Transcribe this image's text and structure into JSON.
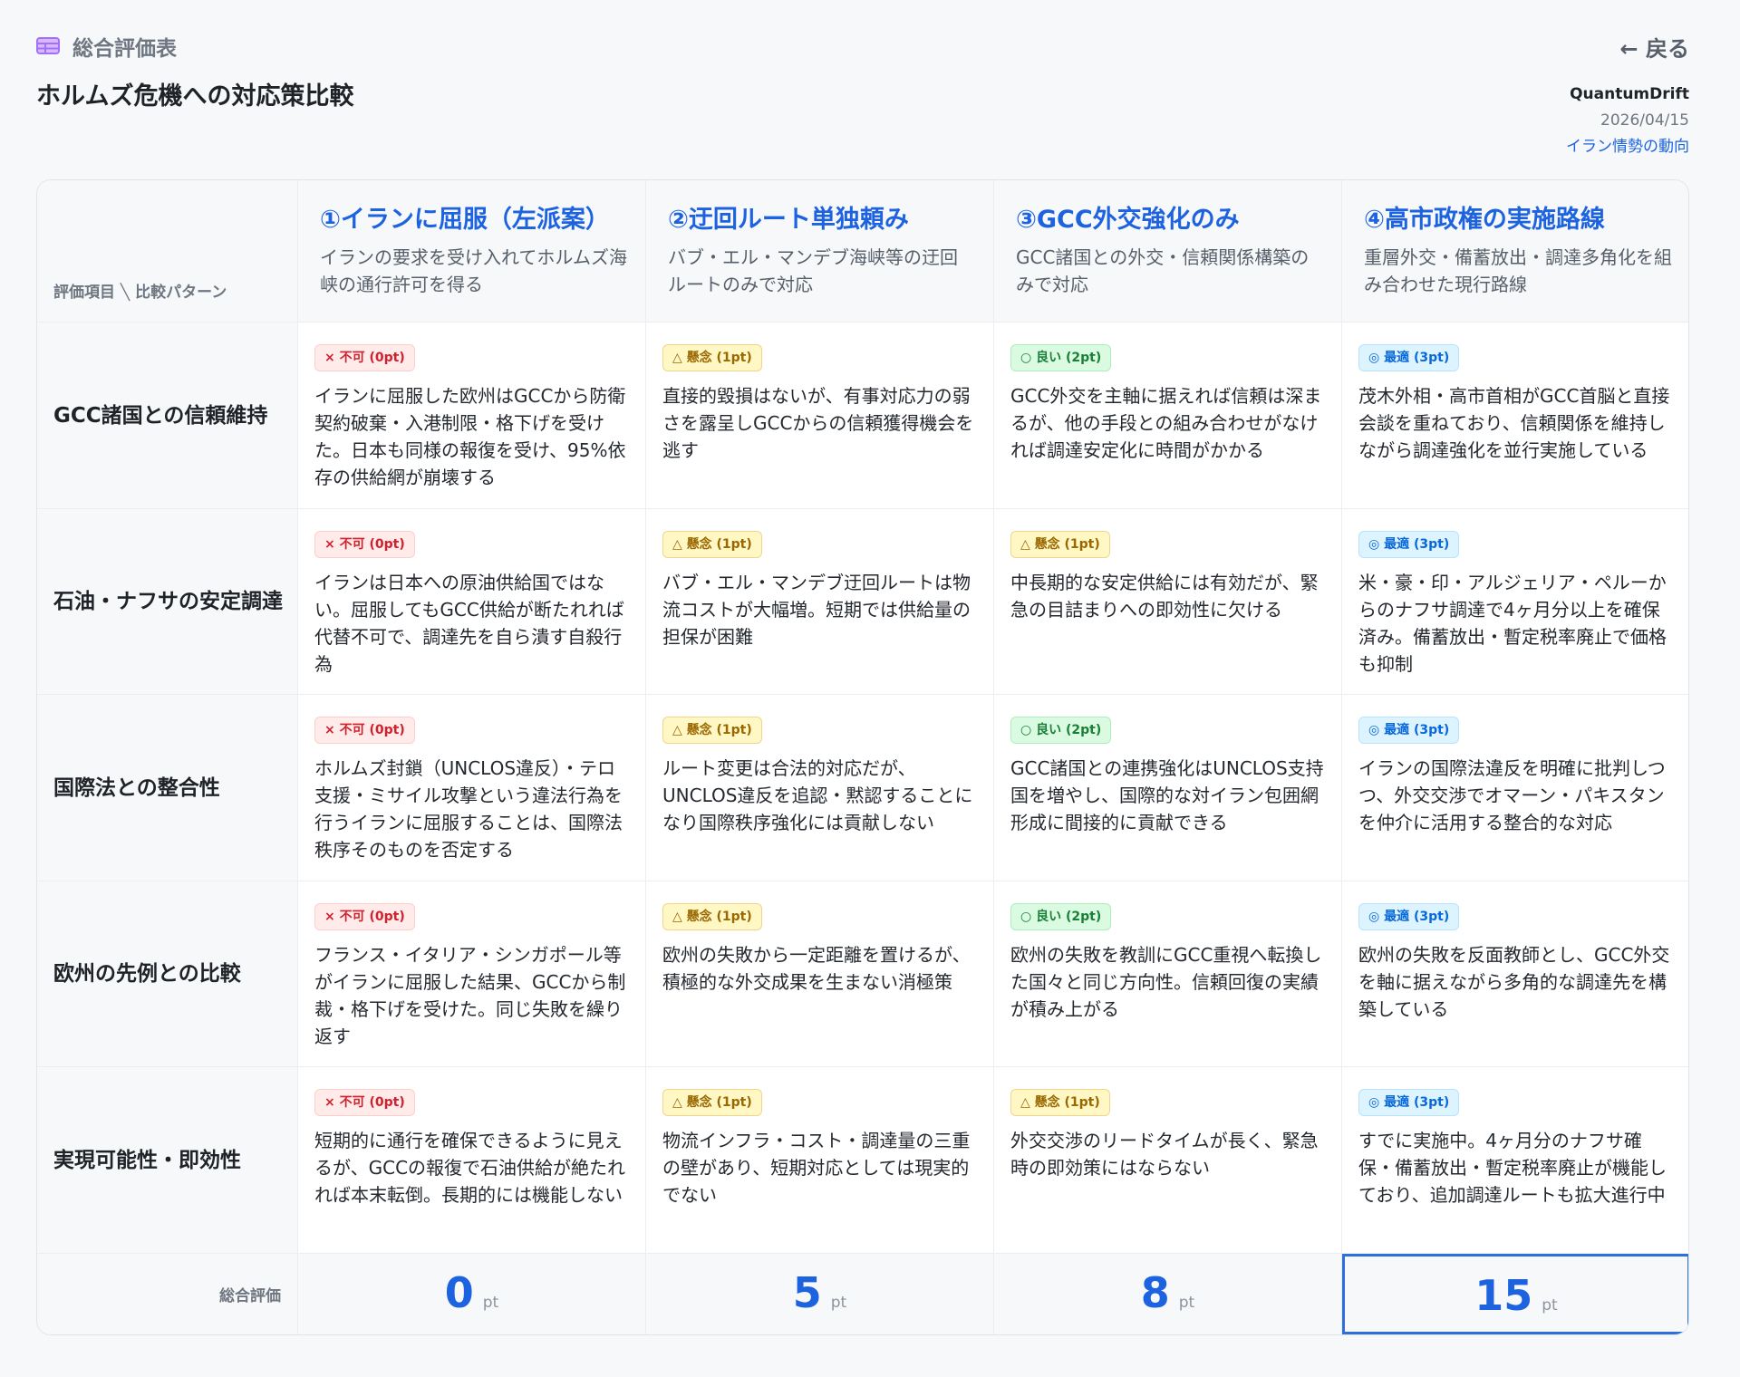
{
  "header": {
    "section_label": "総合評価表",
    "back_label": "← 戻る",
    "title": "ホルムズ危機への対応策比較",
    "author": "QuantumDrift",
    "date": "2026/04/15",
    "topic_link": "イラン情勢の動向",
    "icon": "table-icon",
    "accent_color": "#a371f7"
  },
  "table": {
    "corner_label": "評価項目 ╲ 比較パターン",
    "columns": [
      {
        "title": "①イランに屈服（左派案）",
        "desc": "イランの要求を受け入れてホルムズ海峡の通行許可を得る"
      },
      {
        "title": "②迂回ルート単独頼み",
        "desc": "バブ・エル・マンデブ海峡等の迂回ルートのみで対応"
      },
      {
        "title": "③GCC外交強化のみ",
        "desc": "GCC諸国との外交・信頼関係構築のみで対応"
      },
      {
        "title": "④高市政権の実施路線",
        "desc": "重層外交・備蓄放出・調達多角化を組み合わせた現行路線"
      }
    ],
    "rows": [
      {
        "label": "GCC諸国との信頼維持",
        "cells": [
          {
            "badge": "× 不可 (0pt)",
            "text": "イランに屈服した欧州はGCCから防衛契約破棄・入港制限・格下げを受けた。日本も同様の報復を受け、95%依存の供給網が崩壊する"
          },
          {
            "badge": "△ 懸念 (1pt)",
            "text": "直接的毀損はないが、有事対応力の弱さを露呈しGCCからの信頼獲得機会を逃す"
          },
          {
            "badge": "○ 良い (2pt)",
            "text": "GCC外交を主軸に据えれば信頼は深まるが、他の手段との組み合わせがなければ調達安定化に時間がかかる"
          },
          {
            "badge": "◎ 最適 (3pt)",
            "text": "茂木外相・高市首相がGCC首脳と直接会談を重ねており、信頼関係を維持しながら調達強化を並行実施している"
          }
        ]
      },
      {
        "label": "石油・ナフサの安定調達",
        "cells": [
          {
            "badge": "× 不可 (0pt)",
            "text": "イランは日本への原油供給国ではない。屈服してもGCC供給が断たれれば代替不可で、調達先を自ら潰す自殺行為"
          },
          {
            "badge": "△ 懸念 (1pt)",
            "text": "バブ・エル・マンデブ迂回ルートは物流コストが大幅増。短期では供給量の担保が困難"
          },
          {
            "badge": "△ 懸念 (1pt)",
            "text": "中長期的な安定供給には有効だが、緊急の目詰まりへの即効性に欠ける"
          },
          {
            "badge": "◎ 最適 (3pt)",
            "text": "米・豪・印・アルジェリア・ペルーからのナフサ調達で4ヶ月分以上を確保済み。備蓄放出・暫定税率廃止で価格も抑制"
          }
        ]
      },
      {
        "label": "国際法との整合性",
        "cells": [
          {
            "badge": "× 不可 (0pt)",
            "text": "ホルムズ封鎖（UNCLOS違反）・テロ支援・ミサイル攻撃という違法行為を行うイランに屈服することは、国際法秩序そのものを否定する"
          },
          {
            "badge": "△ 懸念 (1pt)",
            "text": "ルート変更は合法的対応だが、UNCLOS違反を追認・黙認することになり国際秩序強化には貢献しない"
          },
          {
            "badge": "○ 良い (2pt)",
            "text": "GCC諸国との連携強化はUNCLOS支持国を増やし、国際的な対イラン包囲網形成に間接的に貢献できる"
          },
          {
            "badge": "◎ 最適 (3pt)",
            "text": "イランの国際法違反を明確に批判しつつ、外交交渉でオマーン・パキスタンを仲介に活用する整合的な対応"
          }
        ]
      },
      {
        "label": "欧州の先例との比較",
        "cells": [
          {
            "badge": "× 不可 (0pt)",
            "text": "フランス・イタリア・シンガポール等がイランに屈服した結果、GCCから制裁・格下げを受けた。同じ失敗を繰り返す"
          },
          {
            "badge": "△ 懸念 (1pt)",
            "text": "欧州の失敗から一定距離を置けるが、積極的な外交成果を生まない消極策"
          },
          {
            "badge": "○ 良い (2pt)",
            "text": "欧州の失敗を教訓にGCC重視へ転換した国々と同じ方向性。信頼回復の実績が積み上がる"
          },
          {
            "badge": "◎ 最適 (3pt)",
            "text": "欧州の失敗を反面教師とし、GCC外交を軸に据えながら多角的な調達先を構築している"
          }
        ]
      },
      {
        "label": "実現可能性・即効性",
        "cells": [
          {
            "badge": "× 不可 (0pt)",
            "text": "短期的に通行を確保できるように見えるが、GCCの報復で石油供給が絶たれれば本末転倒。長期的には機能しない"
          },
          {
            "badge": "△ 懸念 (1pt)",
            "text": "物流インフラ・コスト・調達量の三重の壁があり、短期対応としては現実的でない"
          },
          {
            "badge": "△ 懸念 (1pt)",
            "text": "外交交渉のリードタイムが長く、緊急時の即効策にはならない"
          },
          {
            "badge": "◎ 最適 (3pt)",
            "text": "すでに実施中。4ヶ月分のナフサ確保・備蓄放出・暫定税率廃止が機能しており、追加調達ルートも拡大進行中"
          }
        ]
      }
    ],
    "total_label": "総合評価",
    "totals": [
      {
        "value": "0",
        "unit": "pt"
      },
      {
        "value": "5",
        "unit": "pt"
      },
      {
        "value": "8",
        "unit": "pt"
      },
      {
        "value": "15",
        "unit": "pt"
      }
    ],
    "status_colors": {
      "bad": "#cf222e",
      "warn": "#9a6700",
      "good": "#1a7f37",
      "best": "#0969da"
    }
  }
}
